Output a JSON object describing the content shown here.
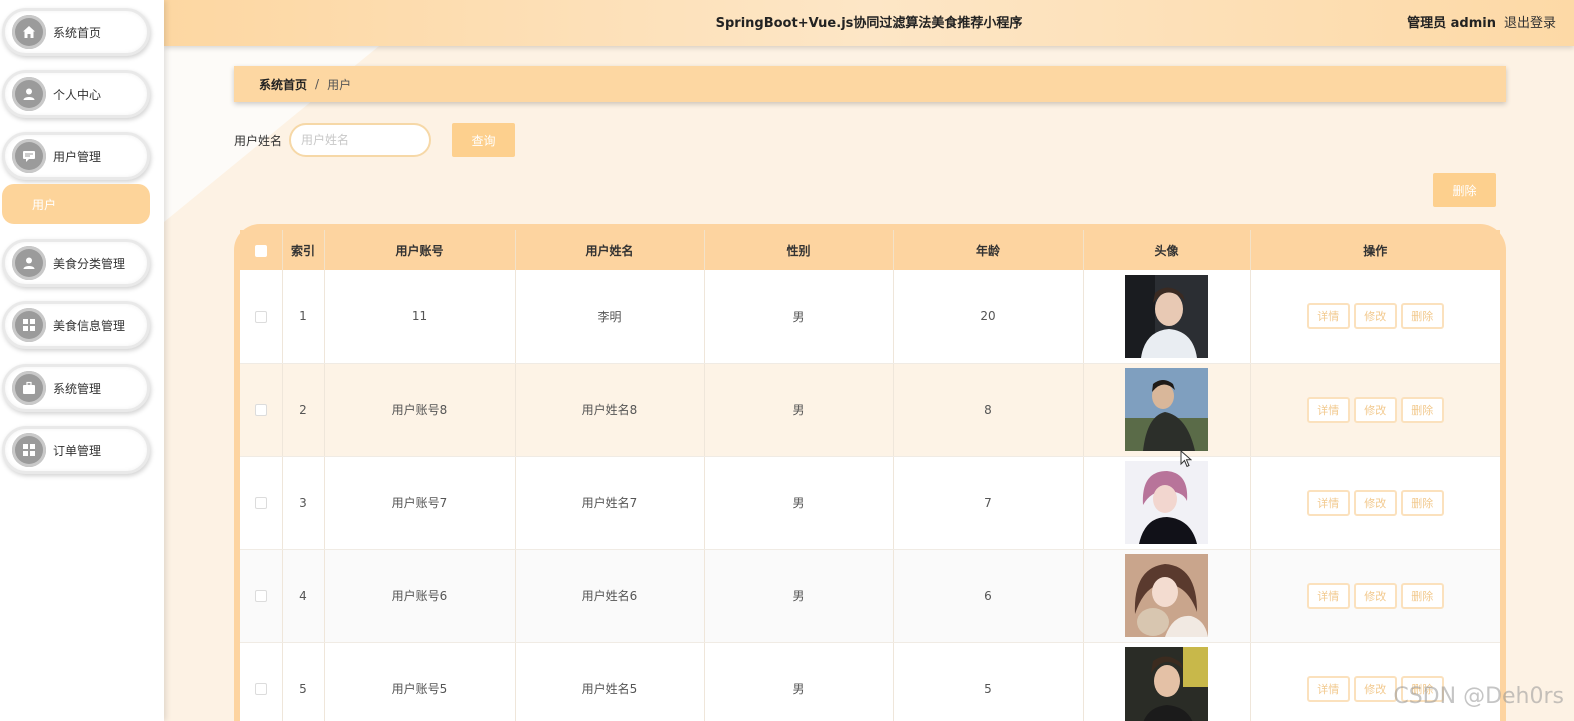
{
  "header": {
    "title": "SpringBoot+Vue.js协同过滤算法美食推荐小程序",
    "user": "管理员 admin",
    "logout": "退出登录"
  },
  "sidebar": {
    "items": [
      {
        "label": "系统首页",
        "icon": "home-icon"
      },
      {
        "label": "个人中心",
        "icon": "person-icon"
      },
      {
        "label": "用户管理",
        "icon": "chat-icon"
      },
      {
        "label": "美食分类管理",
        "icon": "person-icon"
      },
      {
        "label": "美食信息管理",
        "icon": "grid-icon"
      },
      {
        "label": "系统管理",
        "icon": "briefcase-icon"
      },
      {
        "label": "订单管理",
        "icon": "grid-icon"
      }
    ],
    "sub_active": "用户"
  },
  "breadcrumb": {
    "home": "系统首页",
    "sep": "/",
    "current": "用户"
  },
  "search": {
    "label": "用户姓名",
    "placeholder": "用户姓名",
    "button": "查询"
  },
  "delete_button": "删除",
  "table": {
    "headers": [
      "索引",
      "用户账号",
      "用户姓名",
      "性别",
      "年龄",
      "头像",
      "操作"
    ],
    "rows": [
      {
        "index": "1",
        "account": "11",
        "name": "李明",
        "gender": "男",
        "age": "20"
      },
      {
        "index": "2",
        "account": "用户账号8",
        "name": "用户姓名8",
        "gender": "男",
        "age": "8"
      },
      {
        "index": "3",
        "account": "用户账号7",
        "name": "用户姓名7",
        "gender": "男",
        "age": "7"
      },
      {
        "index": "4",
        "account": "用户账号6",
        "name": "用户姓名6",
        "gender": "男",
        "age": "6"
      },
      {
        "index": "5",
        "account": "用户账号5",
        "name": "用户姓名5",
        "gender": "男",
        "age": "5"
      }
    ],
    "actions": {
      "detail": "详情",
      "edit": "修改",
      "delete": "删除"
    }
  },
  "watermark": "CSDN @Deh0rs"
}
